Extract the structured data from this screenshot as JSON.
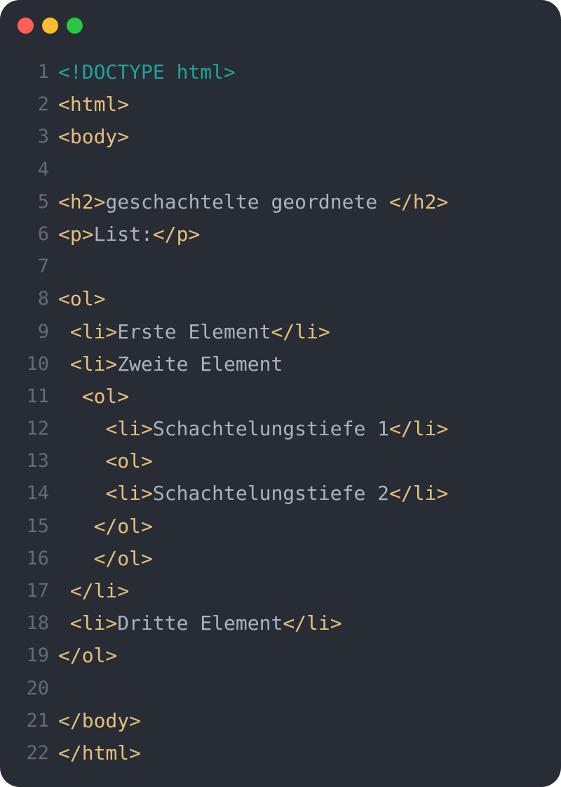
{
  "window": {
    "background": "#282c34",
    "controls": [
      {
        "name": "close",
        "color": "#ff5f57"
      },
      {
        "name": "minimize",
        "color": "#febc2e"
      },
      {
        "name": "maximize",
        "color": "#28c840"
      }
    ]
  },
  "colors": {
    "doctype": "#20a39e",
    "tag": "#e6c07b",
    "text": "#abb2bf",
    "line_number": "#636b78"
  },
  "code": {
    "lines": [
      {
        "num": "1",
        "indent": "",
        "tokens": [
          {
            "t": "doctype",
            "v": "<!DOCTYPE html>"
          }
        ]
      },
      {
        "num": "2",
        "indent": "",
        "tokens": [
          {
            "t": "tag",
            "v": "<html>"
          }
        ]
      },
      {
        "num": "3",
        "indent": "",
        "tokens": [
          {
            "t": "tag",
            "v": "<body>"
          }
        ]
      },
      {
        "num": "4",
        "indent": "",
        "tokens": []
      },
      {
        "num": "5",
        "indent": "",
        "tokens": [
          {
            "t": "tag",
            "v": "<h2>"
          },
          {
            "t": "text",
            "v": "geschachtelte geordnete "
          },
          {
            "t": "tag",
            "v": "</h2>"
          }
        ]
      },
      {
        "num": "6",
        "indent": "",
        "tokens": [
          {
            "t": "tag",
            "v": "<p>"
          },
          {
            "t": "text",
            "v": "List:"
          },
          {
            "t": "tag",
            "v": "</p>"
          }
        ]
      },
      {
        "num": "7",
        "indent": "",
        "tokens": []
      },
      {
        "num": "8",
        "indent": "",
        "tokens": [
          {
            "t": "tag",
            "v": "<ol>"
          }
        ]
      },
      {
        "num": "9",
        "indent": " ",
        "tokens": [
          {
            "t": "tag",
            "v": "<li>"
          },
          {
            "t": "text",
            "v": "Erste Element"
          },
          {
            "t": "tag",
            "v": "</li>"
          }
        ]
      },
      {
        "num": "10",
        "indent": " ",
        "tokens": [
          {
            "t": "tag",
            "v": "<li>"
          },
          {
            "t": "text",
            "v": "Zweite Element"
          }
        ]
      },
      {
        "num": "11",
        "indent": "  ",
        "tokens": [
          {
            "t": "tag",
            "v": "<ol>"
          }
        ]
      },
      {
        "num": "12",
        "indent": "    ",
        "tokens": [
          {
            "t": "tag",
            "v": "<li>"
          },
          {
            "t": "text",
            "v": "Schachtelungstiefe 1"
          },
          {
            "t": "tag",
            "v": "</li>"
          }
        ]
      },
      {
        "num": "13",
        "indent": "    ",
        "tokens": [
          {
            "t": "tag",
            "v": "<ol>"
          }
        ]
      },
      {
        "num": "14",
        "indent": "    ",
        "tokens": [
          {
            "t": "tag",
            "v": "<li>"
          },
          {
            "t": "text",
            "v": "Schachtelungstiefe 2"
          },
          {
            "t": "tag",
            "v": "</li>"
          }
        ]
      },
      {
        "num": "15",
        "indent": "   ",
        "tokens": [
          {
            "t": "tag",
            "v": "</ol>"
          }
        ]
      },
      {
        "num": "16",
        "indent": "   ",
        "tokens": [
          {
            "t": "tag",
            "v": "</ol>"
          }
        ]
      },
      {
        "num": "17",
        "indent": " ",
        "tokens": [
          {
            "t": "tag",
            "v": "</li>"
          }
        ]
      },
      {
        "num": "18",
        "indent": " ",
        "tokens": [
          {
            "t": "tag",
            "v": "<li>"
          },
          {
            "t": "text",
            "v": "Dritte Element"
          },
          {
            "t": "tag",
            "v": "</li>"
          }
        ]
      },
      {
        "num": "19",
        "indent": "",
        "tokens": [
          {
            "t": "tag",
            "v": "</ol>"
          }
        ]
      },
      {
        "num": "20",
        "indent": "",
        "tokens": []
      },
      {
        "num": "21",
        "indent": "",
        "tokens": [
          {
            "t": "tag",
            "v": "</body>"
          }
        ]
      },
      {
        "num": "22",
        "indent": "",
        "tokens": [
          {
            "t": "tag",
            "v": "</html>"
          }
        ]
      }
    ]
  }
}
